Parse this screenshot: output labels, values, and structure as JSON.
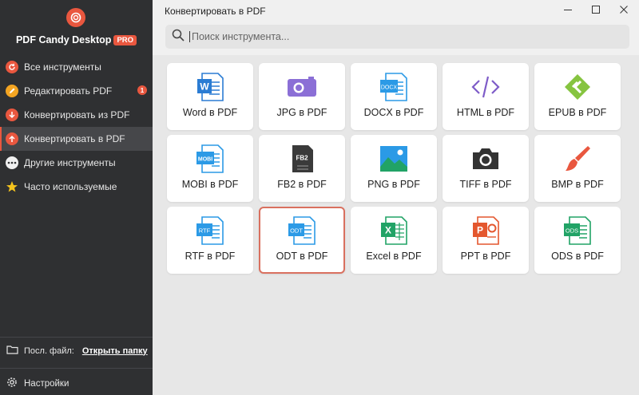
{
  "app": {
    "title": "PDF Candy Desktop",
    "badge": "PRO",
    "accent": "#e9573f"
  },
  "sidebar": {
    "items": [
      {
        "label": "Все инструменты",
        "icon": "refresh-icon",
        "color": "#e9573f"
      },
      {
        "label": "Редактировать PDF",
        "icon": "edit-icon",
        "color": "#f4a522",
        "badge": "1"
      },
      {
        "label": "Конвертировать из PDF",
        "icon": "arrow-down-icon",
        "color": "#e9573f"
      },
      {
        "label": "Конвертировать в PDF",
        "icon": "arrow-up-icon",
        "color": "#e9573f",
        "active": true
      },
      {
        "label": "Другие инструменты",
        "icon": "more-icon",
        "color": "#f0f0f0"
      },
      {
        "label": "Часто используемые",
        "icon": "star-icon",
        "color": "#f4c31d"
      }
    ],
    "last_file_label": "Посл. файл:",
    "open_folder_link": "Открыть папку",
    "settings_label": "Настройки"
  },
  "window": {
    "title": "Конвертировать в PDF"
  },
  "search": {
    "placeholder": "Поиск инструмента..."
  },
  "tools": [
    {
      "label": "Word в PDF",
      "icon": "word-doc-icon",
      "color": "#2b7cd3",
      "tag": "W"
    },
    {
      "label": "JPG в PDF",
      "icon": "camera-icon",
      "color": "#8b6fd6"
    },
    {
      "label": "DOCX в PDF",
      "icon": "docx-doc-icon",
      "color": "#2b9ae6",
      "tag": "DOCX"
    },
    {
      "label": "HTML в PDF",
      "icon": "code-icon",
      "color": "#7e5cc8"
    },
    {
      "label": "EPUB в PDF",
      "icon": "epub-icon",
      "color": "#86c440"
    },
    {
      "label": "MOBI в PDF",
      "icon": "mobi-doc-icon",
      "color": "#2b9ae6",
      "tag": "MOBI"
    },
    {
      "label": "FB2 в PDF",
      "icon": "fb2-doc-icon",
      "color": "#3a3a3a",
      "tag": "FB2"
    },
    {
      "label": "PNG в PDF",
      "icon": "image-icon",
      "color": "#2b9ae6"
    },
    {
      "label": "TIFF в PDF",
      "icon": "photo-camera-icon",
      "color": "#333333"
    },
    {
      "label": "BMP в PDF",
      "icon": "brush-icon",
      "color": "#e9573f"
    },
    {
      "label": "RTF в PDF",
      "icon": "rtf-doc-icon",
      "color": "#2b9ae6",
      "tag": "RTF"
    },
    {
      "label": "ODT в PDF",
      "icon": "odt-doc-icon",
      "color": "#2b9ae6",
      "tag": "ODT",
      "selected": true
    },
    {
      "label": "Excel в PDF",
      "icon": "excel-icon",
      "color": "#21a366",
      "tag": "X"
    },
    {
      "label": "PPT в PDF",
      "icon": "ppt-icon",
      "color": "#e4572e",
      "tag": "P"
    },
    {
      "label": "ODS в PDF",
      "icon": "ods-doc-icon",
      "color": "#21a366",
      "tag": "ODS"
    }
  ]
}
